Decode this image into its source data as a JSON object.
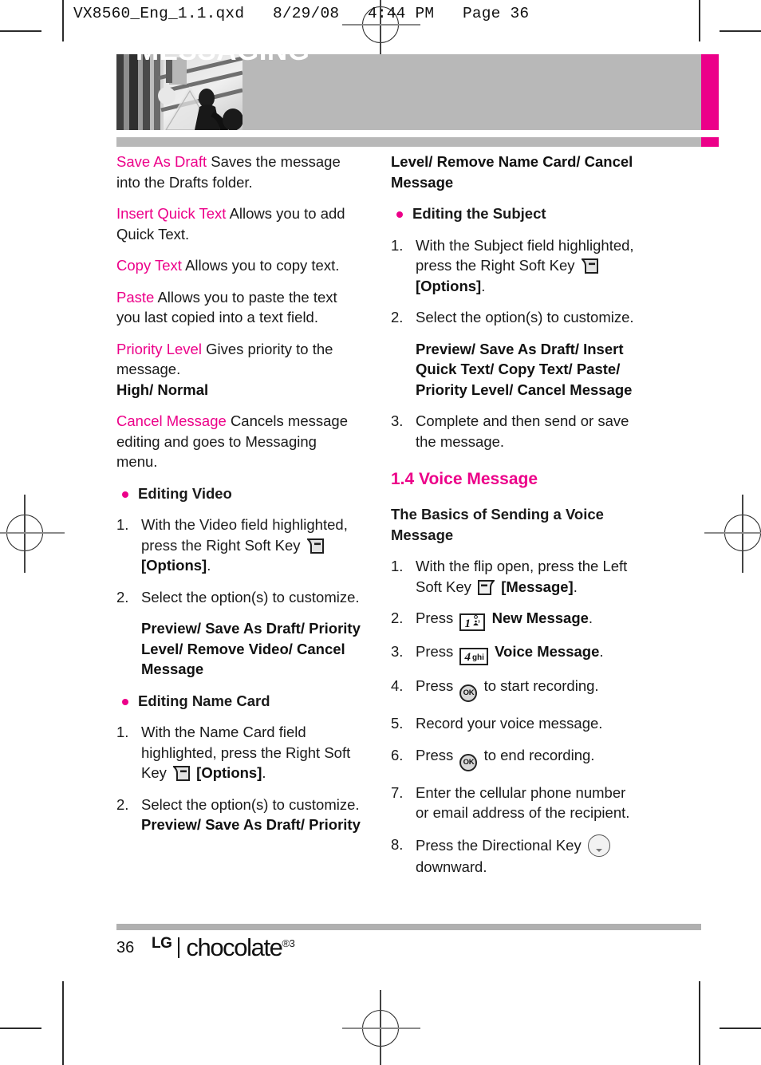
{
  "file_header": "VX8560_Eng_1.1.qxd   8/29/08   4:44 PM   Page 36",
  "header": {
    "title": "MESSAGING",
    "band_color": "#b8b8b8",
    "tab_color": "#ec0089"
  },
  "colors": {
    "accent_magenta": "#ec0089",
    "band_gray": "#b8b8b8",
    "body_black": "#1a1a1a"
  },
  "icons": {
    "right_soft_key": "right-soft-key-icon",
    "left_soft_key": "left-soft-key-icon",
    "ok_key": "OK",
    "key_1_digit": "1",
    "key_4_digit": "4",
    "key_4_letters": "ghi",
    "directional_key": "directional-key-icon"
  },
  "left_column": {
    "glossary": [
      {
        "term": "Save As Draft",
        "desc": "Saves the message into the Drafts folder."
      },
      {
        "term": "Insert Quick Text",
        "desc": "Allows you to add Quick Text."
      },
      {
        "term": "Copy Text",
        "desc": "Allows you to copy text."
      },
      {
        "term": "Paste",
        "desc": "Allows you to paste the text you last copied into a text field."
      },
      {
        "term": "Priority Level",
        "desc": "Gives priority to the message.",
        "bold_tail": "High/ Normal"
      },
      {
        "term": "Cancel Message",
        "desc": "Cancels message editing and goes to Messaging menu."
      }
    ],
    "editing_video": {
      "bullet": "Editing Video",
      "step1_num": "1.",
      "step1_a": "With the Video field highlighted, press the Right Soft Key",
      "step1_b": "[Options]",
      "step1_c": ".",
      "step2_num": "2.",
      "step2": "Select the option(s) to customize.",
      "options": "Preview/ Save As Draft/ Priority Level/ Remove Video/ Cancel Message"
    },
    "editing_name_card": {
      "bullet": "Editing Name Card",
      "step1_num": "1.",
      "step1_a": "With the Name Card field highlighted, press the Right Soft Key",
      "step1_b": "[Options]",
      "step1_c": ".",
      "step2_num": "2.",
      "step2": "Select the option(s) to customize.",
      "options_partial": "Preview/ Save As Draft/ Priority"
    }
  },
  "right_column": {
    "options_continued": "Level/ Remove Name Card/ Cancel Message",
    "editing_subject": {
      "bullet": "Editing the Subject",
      "step1_num": "1.",
      "step1_a": "With the Subject field highlighted, press the Right Soft Key",
      "step1_b": "[Options]",
      "step1_c": ".",
      "step2_num": "2.",
      "step2": "Select the option(s) to customize.",
      "options": "Preview/ Save As Draft/ Insert Quick Text/ Copy Text/ Paste/ Priority Level/ Cancel Message",
      "step3_num": "3.",
      "step3": "Complete and then send or save the message."
    },
    "section": {
      "heading": "1.4 Voice Message",
      "subhead": "The Basics of Sending a Voice Message",
      "steps": [
        {
          "n": "1.",
          "a": "With the flip open, press the Left Soft Key",
          "icon": "left-soft-key",
          "b": "[Message]",
          "c": "."
        },
        {
          "n": "2.",
          "a": "Press",
          "icon": "key-1",
          "b": "New Message",
          "c": "."
        },
        {
          "n": "3.",
          "a": "Press",
          "icon": "key-4",
          "b": "Voice Message",
          "c": "."
        },
        {
          "n": "4.",
          "a": "Press",
          "icon": "ok-key",
          "c": "to start recording."
        },
        {
          "n": "5.",
          "a": "Record your voice message."
        },
        {
          "n": "6.",
          "a": "Press",
          "icon": "ok-key",
          "c": "to end recording."
        },
        {
          "n": "7.",
          "a": "Enter the cellular phone number or email address of the recipient."
        },
        {
          "n": "8.",
          "a": "Press the Directional Key",
          "icon": "directional-key",
          "c": "downward."
        }
      ]
    }
  },
  "footer": {
    "page_number": "36",
    "brand": "LG",
    "product": "chocolate",
    "product_sup": "®3"
  }
}
